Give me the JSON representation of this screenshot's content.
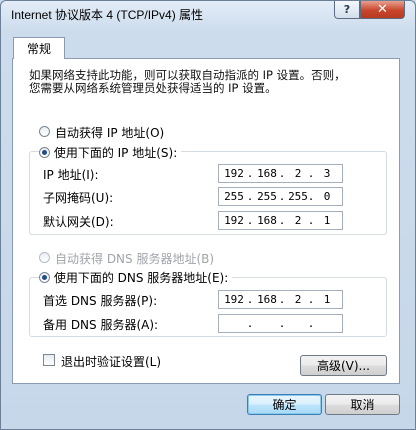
{
  "window": {
    "title": "Internet 协议版本 4 (TCP/IPv4) 属性",
    "help_glyph": "?",
    "close_glyph": "✕"
  },
  "tab": {
    "label": "常规"
  },
  "description": {
    "line1": "如果网络支持此功能，则可以获取自动指派的 IP 设置。否则，",
    "line2": "您需要从网络系统管理员处获得适当的 IP 设置。"
  },
  "ip": {
    "auto_label": "自动获得 IP 地址(O)",
    "auto_selected": false,
    "manual_label": "使用下面的 IP 地址(S):",
    "manual_selected": true,
    "fields": [
      {
        "label": "IP 地址(I):",
        "octets": [
          "192",
          "168",
          "2",
          "3"
        ]
      },
      {
        "label": "子网掩码(U):",
        "octets": [
          "255",
          "255",
          "255",
          "0"
        ]
      },
      {
        "label": "默认网关(D):",
        "octets": [
          "192",
          "168",
          "2",
          "1"
        ]
      }
    ]
  },
  "dns": {
    "auto_label": "自动获得 DNS 服务器地址(B)",
    "auto_selected": false,
    "manual_label": "使用下面的 DNS 服务器地址(E):",
    "manual_selected": true,
    "fields": [
      {
        "label": "首选 DNS 服务器(P):",
        "octets": [
          "192",
          "168",
          "2",
          "1"
        ]
      },
      {
        "label": "备用 DNS 服务器(A):",
        "octets": [
          "",
          "",
          "",
          ""
        ]
      }
    ]
  },
  "validate": {
    "label": "退出时验证设置(L)",
    "checked": false
  },
  "buttons": {
    "advanced": "高级(V)...",
    "ok": "确定",
    "cancel": "取消"
  },
  "ip_separator": "."
}
